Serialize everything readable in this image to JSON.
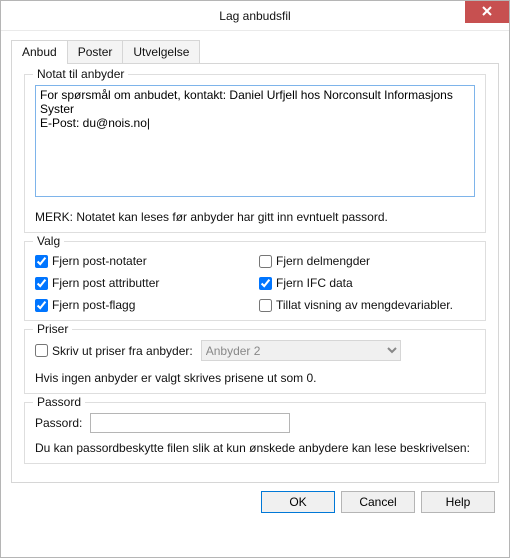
{
  "window": {
    "title": "Lag anbudsfil"
  },
  "tabs": {
    "anbud": "Anbud",
    "poster": "Poster",
    "utvelgelse": "Utvelgelse"
  },
  "notat": {
    "legend": "Notat til anbyder",
    "value": "For spørsmål om anbudet, kontakt: Daniel Urfjell hos Norconsult Informasjons Syster\nE-Post: du@nois.no|",
    "note": "MERK: Notatet kan leses før anbyder har gitt inn evntuelt passord."
  },
  "valg": {
    "legend": "Valg",
    "fjern_post_notater": "Fjern post-notater",
    "fjern_delmengder": "Fjern delmengder",
    "fjern_post_attributter": "Fjern post attributter",
    "fjern_ifc_data": "Fjern IFC data",
    "fjern_post_flagg": "Fjern post-flagg",
    "tillat_mengdevariabler": "Tillat visning av mengdevariabler.",
    "checked": {
      "fjern_post_notater": true,
      "fjern_delmengder": false,
      "fjern_post_attributter": true,
      "fjern_ifc_data": true,
      "fjern_post_flagg": true,
      "tillat_mengdevariabler": false
    }
  },
  "priser": {
    "legend": "Priser",
    "skriv_ut_label": "Skriv ut priser fra anbyder:",
    "skriv_ut_checked": false,
    "selected": "Anbyder 2",
    "note": "Hvis ingen anbyder er valgt skrives prisene ut som 0."
  },
  "passord": {
    "legend": "Passord",
    "label": "Passord:",
    "value": "",
    "note": "Du kan passordbeskytte filen slik at kun ønskede anbydere kan lese beskrivelsen:"
  },
  "buttons": {
    "ok": "OK",
    "cancel": "Cancel",
    "help": "Help"
  }
}
